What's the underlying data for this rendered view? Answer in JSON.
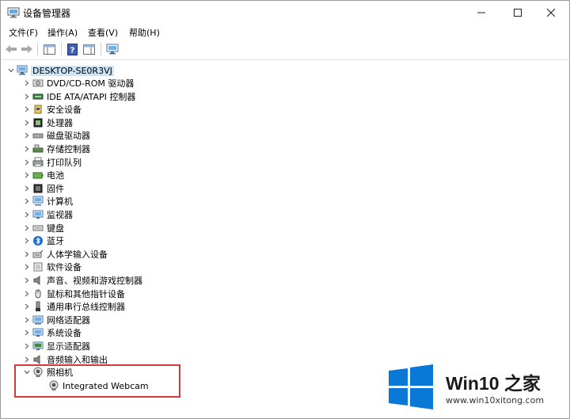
{
  "window": {
    "title": "设备管理器"
  },
  "menu": [
    "文件(F)",
    "操作(A)",
    "查看(V)",
    "帮助(H)"
  ],
  "tree": {
    "root": "DESKTOP-SE0R3VJ",
    "categories": [
      {
        "label": "DVD/CD-ROM 驱动器",
        "icon": "dvd-drive-icon"
      },
      {
        "label": "IDE ATA/ATAPI 控制器",
        "icon": "ide-controller-icon"
      },
      {
        "label": "安全设备",
        "icon": "security-device-icon"
      },
      {
        "label": "处理器",
        "icon": "processor-icon"
      },
      {
        "label": "磁盘驱动器",
        "icon": "disk-drive-icon"
      },
      {
        "label": "存储控制器",
        "icon": "storage-controller-icon"
      },
      {
        "label": "打印队列",
        "icon": "printer-icon"
      },
      {
        "label": "电池",
        "icon": "battery-icon"
      },
      {
        "label": "固件",
        "icon": "firmware-icon"
      },
      {
        "label": "计算机",
        "icon": "computer-icon"
      },
      {
        "label": "监视器",
        "icon": "monitor-icon"
      },
      {
        "label": "键盘",
        "icon": "keyboard-icon"
      },
      {
        "label": "蓝牙",
        "icon": "bluetooth-icon"
      },
      {
        "label": "人体学输入设备",
        "icon": "hid-icon"
      },
      {
        "label": "软件设备",
        "icon": "software-device-icon"
      },
      {
        "label": "声音、视频和游戏控制器",
        "icon": "speaker-icon"
      },
      {
        "label": "鼠标和其他指针设备",
        "icon": "mouse-icon"
      },
      {
        "label": "通用串行总线控制器",
        "icon": "usb-icon"
      },
      {
        "label": "网络适配器",
        "icon": "network-adapter-icon"
      },
      {
        "label": "系统设备",
        "icon": "system-device-icon"
      },
      {
        "label": "显示适配器",
        "icon": "display-adapter-icon"
      },
      {
        "label": "音频输入和输出",
        "icon": "audio-io-icon"
      },
      {
        "label": "照相机",
        "icon": "camera-icon"
      }
    ],
    "camera_child": "Integrated Webcam"
  },
  "watermark": {
    "title": "Win10 之家",
    "url": "www.win10xitong.com"
  },
  "colors": {
    "selection": "#cce4f7",
    "highlight_border": "#d43a3a",
    "win_blue": "#0a78d7"
  }
}
